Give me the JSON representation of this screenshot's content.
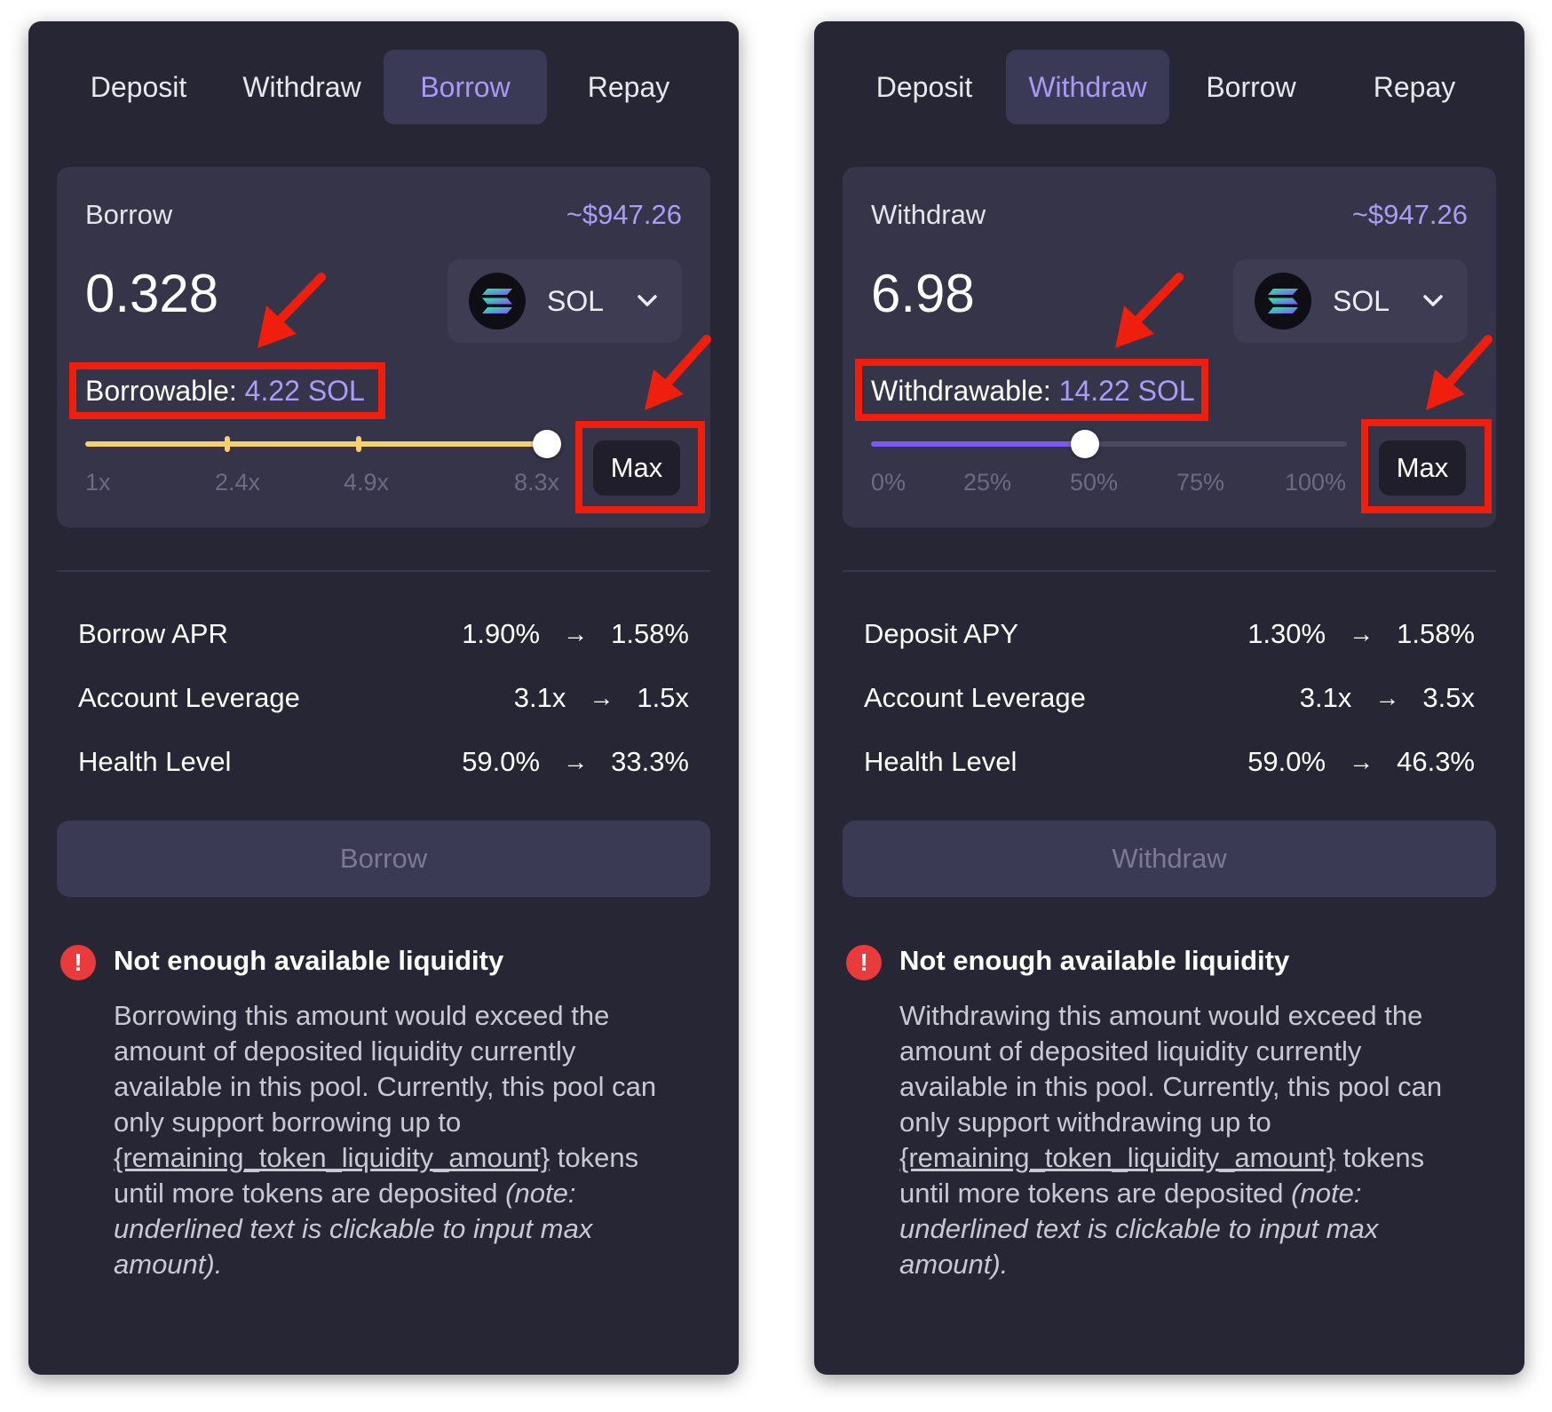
{
  "panels": [
    {
      "tabs": [
        "Deposit",
        "Withdraw",
        "Borrow",
        "Repay"
      ],
      "active_tab": "Borrow",
      "form": {
        "title": "Borrow",
        "usd_value": "~$947.26",
        "amount": "0.328",
        "token": "SOL",
        "limit_label": "Borrowable:",
        "limit_value": "4.22 SOL",
        "slider": {
          "labels": [
            "1x",
            "2.4x",
            "4.9x",
            "8.3x"
          ],
          "color": "#f6d06b",
          "level": 1.0
        },
        "max_label": "Max"
      },
      "stats": [
        {
          "label": "Borrow APR",
          "from": "1.90%",
          "arrow": "→",
          "to": "1.58%"
        },
        {
          "label": "Account Leverage",
          "from": "3.1x",
          "arrow": "→",
          "to": "1.5x"
        },
        {
          "label": "Health Level",
          "from": "59.0%",
          "arrow": "→",
          "to": "33.3%"
        }
      ],
      "action_label": "Borrow",
      "warning": {
        "icon": "!",
        "title": "Not enough available liquidity",
        "text_1": "Borrowing this amount would exceed the amount of deposited liquidity currently available in this pool. Currently, this pool can only support borrowing up to ",
        "link": "{remaining_token_liquidity_amount}",
        "text_2": " tokens until more tokens are deposited ",
        "note": "(note: underlined text is clickable to input max amount)."
      }
    },
    {
      "tabs": [
        "Deposit",
        "Withdraw",
        "Borrow",
        "Repay"
      ],
      "active_tab": "Withdraw",
      "form": {
        "title": "Withdraw",
        "usd_value": "~$947.26",
        "amount": "6.98",
        "token": "SOL",
        "limit_label": "Withdrawable:",
        "limit_value": "14.22 SOL",
        "slider": {
          "labels": [
            "0%",
            "25%",
            "50%",
            "75%",
            "100%"
          ],
          "color": "#7a5af0",
          "level": 0.45
        },
        "max_label": "Max"
      },
      "stats": [
        {
          "label": "Deposit APY",
          "from": "1.30%",
          "arrow": "→",
          "to": "1.58%"
        },
        {
          "label": "Account Leverage",
          "from": "3.1x",
          "arrow": "→",
          "to": "3.5x"
        },
        {
          "label": "Health Level",
          "from": "59.0%",
          "arrow": "→",
          "to": "46.3%"
        }
      ],
      "action_label": "Withdraw",
      "warning": {
        "icon": "!",
        "title": "Not enough available liquidity",
        "text_1": "Withdrawing this amount would exceed the amount of deposited liquidity currently available in this pool. Currently, this pool can only support withdrawing up to ",
        "link": "{remaining_token_liquidity_amount}",
        "text_2": " tokens until more tokens are deposited ",
        "note": "(note: underlined text is clickable to input max amount)."
      }
    }
  ],
  "colors": {
    "panel_bg": "#272634",
    "accent": "#a99df5",
    "annotation": "#f01e0c",
    "error": "#e93b3b"
  },
  "icons": {
    "token": "solana-logo-icon",
    "dropdown": "chevron-down-icon",
    "warning": "exclamation-circle-icon",
    "annotation": "red-arrow-icon"
  }
}
